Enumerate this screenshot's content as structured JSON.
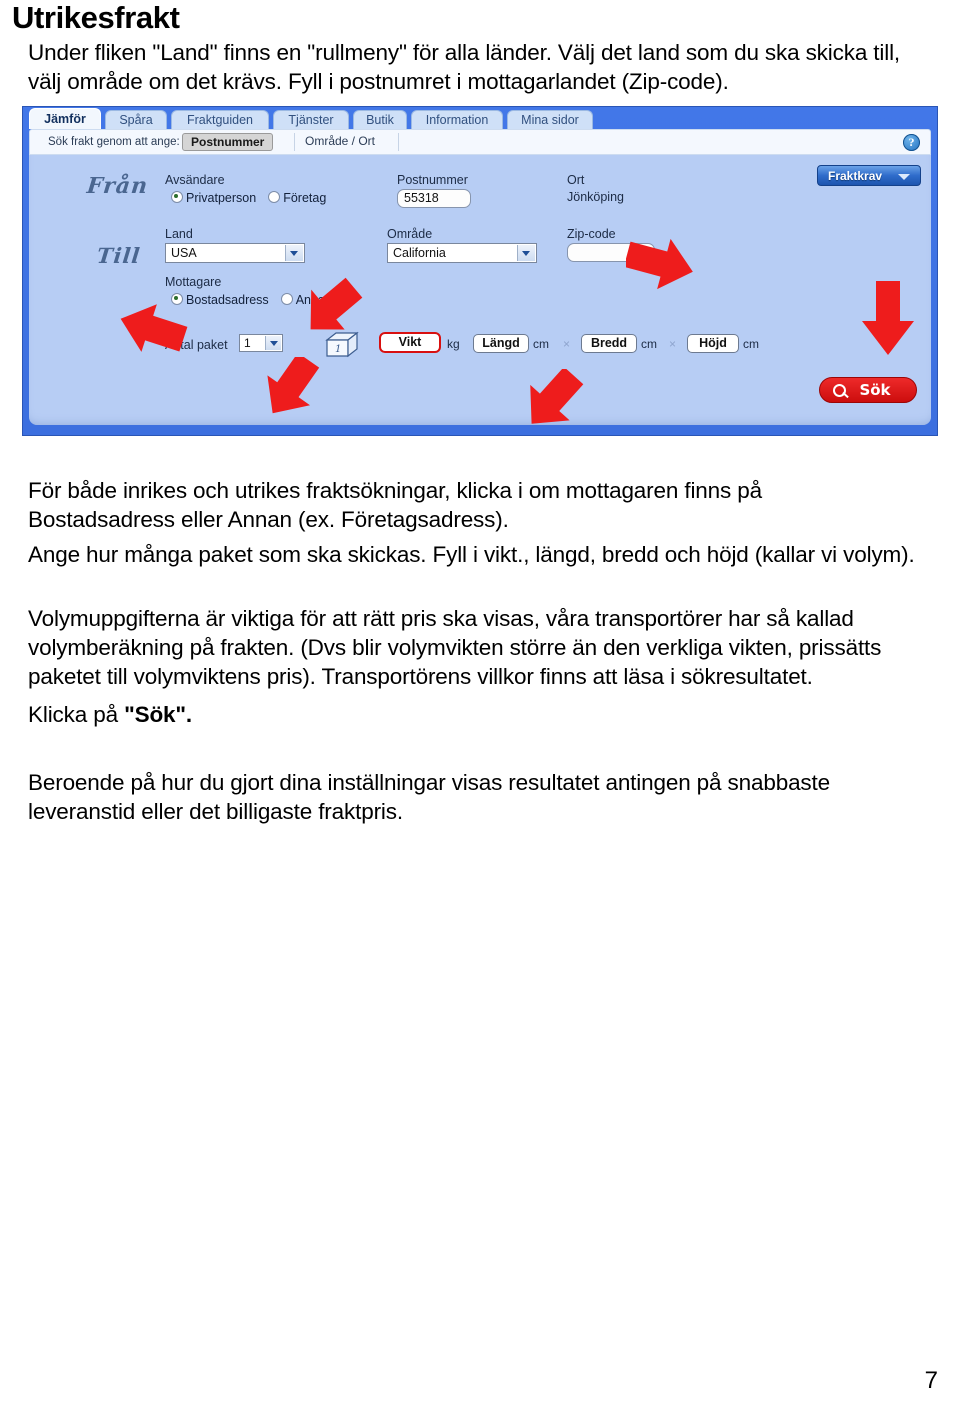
{
  "document": {
    "title": "Utrikesfrakt",
    "intro": "Under fliken \"Land\" finns en \"rullmeny\" för alla länder. Välj det land som du ska skicka till, välj område om det krävs. Fyll i postnumret i mottagarlandet (Zip-code).",
    "para1": "För både inrikes och utrikes fraktsökningar, klicka i om mottagaren finns på Bostadsadress eller Annan (ex. Företagsadress).",
    "para2": "Ange hur många paket som ska skickas. Fyll i vikt., längd, bredd och höjd (kallar vi volym).",
    "para3": "Volymuppgifterna är viktiga för att rätt pris ska visas, våra transportörer har så kallad volymberäkning på frakten. (Dvs blir volymvikten större än den verkliga vikten,  prissätts paketet till volymviktens pris). Transportörens villkor finns att läsa i sökresultatet.",
    "para4_prefix": "Klicka på ",
    "para4_bold": "\"Sök\".",
    "para5": "Beroende på hur du gjort dina inställningar visas resultatet antingen på snabbaste leveranstid eller det billigaste fraktpris.",
    "page_number": "7"
  },
  "screenshot": {
    "tabs": [
      {
        "label": "Jämför",
        "active": true
      },
      {
        "label": "Spåra",
        "active": false
      },
      {
        "label": "Fraktguiden",
        "active": false
      },
      {
        "label": "Tjänster",
        "active": false
      },
      {
        "label": "Butik",
        "active": false
      },
      {
        "label": "Information",
        "active": false
      },
      {
        "label": "Mina sidor",
        "active": false
      }
    ],
    "subbar": {
      "label": "Sök frakt genom att ange:",
      "option_selected": "Postnummer",
      "option_other": "Område / Ort",
      "help_glyph": "?"
    },
    "script_labels": {
      "from": "Från",
      "to": "Till"
    },
    "fraktkrav_button": "Fraktkrav",
    "sender": {
      "label": "Avsändare",
      "radio_private": "Privatperson",
      "radio_company": "Företag",
      "private_selected": true
    },
    "postnummer": {
      "label": "Postnummer",
      "value": "55318"
    },
    "ort": {
      "label": "Ort",
      "value": "Jönköping"
    },
    "land": {
      "label": "Land",
      "value": "USA"
    },
    "omrade": {
      "label": "Område",
      "value": "California"
    },
    "zip": {
      "label": "Zip-code",
      "value": ""
    },
    "mottagare": {
      "label": "Mottagare",
      "radio_home": "Bostadsadress",
      "radio_other": "Annan",
      "home_selected": true
    },
    "packages": {
      "label": "Antal paket",
      "value": "1",
      "box_glyph": "1"
    },
    "dimensions": {
      "weight_label": "Vikt",
      "weight_unit": "kg",
      "length_label": "Längd",
      "length_unit": "cm",
      "width_label": "Bredd",
      "width_unit": "cm",
      "height_label": "Höjd",
      "height_unit": "cm",
      "separator": "×"
    },
    "search_button": "Sök",
    "colors": {
      "panel_blue": "#3c6fdf",
      "form_blue": "#b7cdf4",
      "accent_red": "#e21b1b",
      "annotation_red": "#ee1c1c",
      "tab_active_bg": "#f2f7fd"
    }
  }
}
